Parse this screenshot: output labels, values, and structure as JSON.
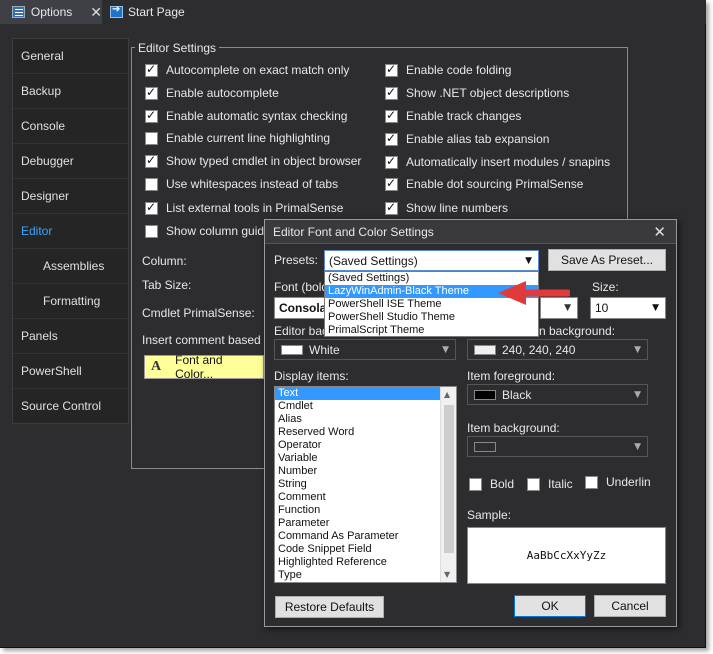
{
  "tabs": [
    {
      "label": "Options",
      "close": "✕"
    },
    {
      "label": "Start Page"
    }
  ],
  "nav": [
    {
      "label": "General"
    },
    {
      "label": "Backup"
    },
    {
      "label": "Console"
    },
    {
      "label": "Debugger"
    },
    {
      "label": "Designer"
    },
    {
      "label": "Editor"
    },
    {
      "label": "Assemblies"
    },
    {
      "label": "Formatting"
    },
    {
      "label": "Panels"
    },
    {
      "label": "PowerShell"
    },
    {
      "label": "Source Control"
    }
  ],
  "editor": {
    "group_title": "Editor Settings",
    "left_checks": [
      {
        "label": "Autocomplete on exact match only",
        "checked": true
      },
      {
        "label": "Enable autocomplete",
        "checked": true
      },
      {
        "label": "Enable automatic syntax checking",
        "checked": true
      },
      {
        "label": "Enable current line highlighting",
        "checked": false
      },
      {
        "label": "Show typed cmdlet in object browser",
        "checked": true
      },
      {
        "label": "Use whitespaces instead of tabs",
        "checked": false
      },
      {
        "label": "List external tools in PrimalSense",
        "checked": true
      },
      {
        "label": "Show column guide",
        "checked": false
      }
    ],
    "right_checks": [
      {
        "label": "Enable code folding",
        "checked": true
      },
      {
        "label": "Show .NET object descriptions",
        "checked": true
      },
      {
        "label": "Enable track changes",
        "checked": true
      },
      {
        "label": "Enable alias tab expansion",
        "checked": true
      },
      {
        "label": "Automatically insert modules / snapins",
        "checked": true
      },
      {
        "label": "Enable dot sourcing PrimalSense",
        "checked": true
      },
      {
        "label": "Show line numbers",
        "checked": true
      }
    ],
    "column_label": "Column:",
    "tab_size_label": "Tab Size:",
    "cmdlet_label": "Cmdlet PrimalSense:",
    "insert_comment_label": "Insert comment based he",
    "font_color_button": "Font and Color...",
    "font_color_icon": "A"
  },
  "dialog": {
    "title": "Editor Font and Color Settings",
    "close": "✕",
    "presets_label": "Presets:",
    "presets_value": "(Saved Settings)",
    "save_preset_button": "Save As Preset...",
    "font_label": "Font (bold",
    "font_value": "Consola",
    "size_label": "Size:",
    "size_value": "10",
    "editor_bg_label": "Editor bac",
    "editor_bg_value": "White",
    "selection_bg_label": "n background:",
    "selection_bg_value": "240, 240, 240",
    "display_items_label": "Display items:",
    "display_items": [
      "Text",
      "Cmdlet",
      "Alias",
      "Reserved Word",
      "Operator",
      "Variable",
      "Number",
      "String",
      "Comment",
      "Function",
      "Parameter",
      "Command As Parameter",
      "Code Snippet Field",
      "Highlighted Reference",
      "Type"
    ],
    "selected_item": "Text",
    "item_fg_label": "Item foreground:",
    "item_fg_value": "Black",
    "item_bg_label": "Item background:",
    "bold_label": "Bold",
    "italic_label": "Italic",
    "underline_label": "Underlin",
    "sample_label": "Sample:",
    "sample_text": "AaBbCcXxYyZz",
    "restore_button": "Restore Defaults",
    "ok_button": "OK",
    "cancel_button": "Cancel",
    "preset_options": [
      "(Saved Settings)",
      "LazyWinAdmin-Black Theme",
      "PowerShell ISE Theme",
      "PowerShell Studio Theme",
      "PrimalScript Theme"
    ],
    "highlighted_option": "LazyWinAdmin-Black Theme"
  },
  "colors": {
    "window_bg": "#2d2d30",
    "accent_blue": "#3ea6ff",
    "highlight": "#3399ff",
    "arrow_red": "#e03a3a",
    "button_yellow": "#ffff99"
  }
}
